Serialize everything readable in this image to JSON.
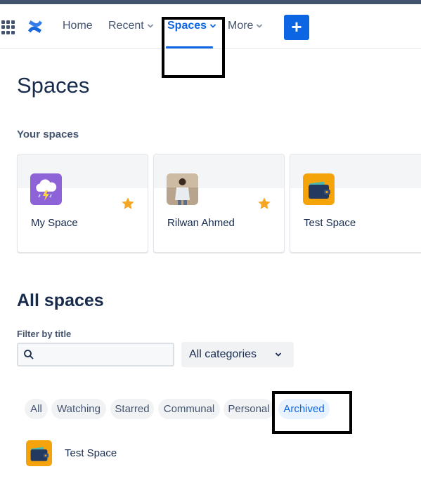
{
  "nav": {
    "home": "Home",
    "recent": "Recent",
    "spaces": "Spaces",
    "more": "More",
    "create_label": "+"
  },
  "colors": {
    "primary": "#0c66e4",
    "text": "#172b4d",
    "subtle": "#44546f",
    "star": "#f5a623",
    "archived_tab_bg": "#e9f2ff"
  },
  "page": {
    "title": "Spaces",
    "your_spaces_heading": "Your spaces"
  },
  "your_spaces": [
    {
      "name": "My Space",
      "starred": true,
      "icon": "storm-cloud-icon"
    },
    {
      "name": "Rilwan Ahmed",
      "starred": true,
      "icon": "person-photo"
    },
    {
      "name": "Test Space",
      "starred": false,
      "icon": "wallet-icon"
    }
  ],
  "all_spaces": {
    "title": "All spaces",
    "filter_label": "Filter by title",
    "filter_value": "",
    "filter_placeholder": "",
    "category_selected": "All categories",
    "tabs": [
      "All",
      "Watching",
      "Starred",
      "Communal",
      "Personal",
      "Archived"
    ],
    "active_tab": "Archived",
    "results": [
      {
        "name": "Test Space",
        "icon": "wallet-icon"
      }
    ]
  }
}
